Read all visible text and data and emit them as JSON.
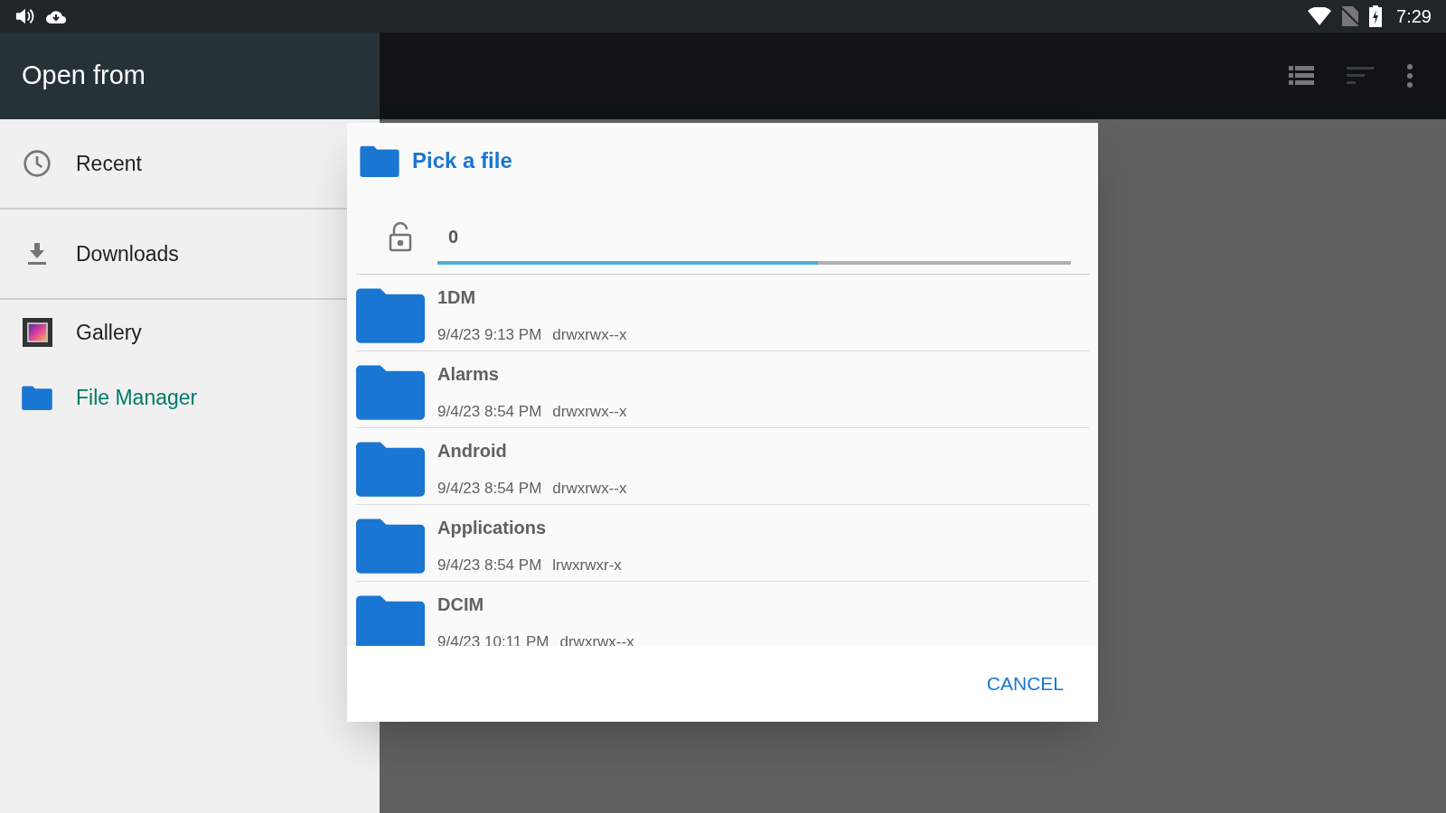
{
  "status_bar": {
    "time": "7:29"
  },
  "drawer": {
    "title": "Open from",
    "items": [
      {
        "label": "Recent",
        "kind": "recent",
        "selected": false,
        "divider_after": true
      },
      {
        "label": "Downloads",
        "kind": "downloads",
        "selected": false,
        "divider_after": true
      },
      {
        "label": "Gallery",
        "kind": "gallery",
        "selected": false,
        "divider_after": false
      },
      {
        "label": "File Manager",
        "kind": "folder",
        "selected": true,
        "divider_after": false
      }
    ]
  },
  "toolbar": {
    "sort_disabled": true
  },
  "dialog": {
    "title": "Pick a file",
    "path": {
      "value": "0",
      "level": 0.6
    },
    "files": [
      {
        "name": "1DM",
        "date": "9/4/23 9:13 PM",
        "permissions": "drwxrwx--x"
      },
      {
        "name": "Alarms",
        "date": "9/4/23 8:54 PM",
        "permissions": "drwxrwx--x"
      },
      {
        "name": "Android",
        "date": "9/4/23 8:54 PM",
        "permissions": "drwxrwx--x"
      },
      {
        "name": "Applications",
        "date": "9/4/23 8:54 PM",
        "permissions": "lrwxrwxr-x"
      },
      {
        "name": "DCIM",
        "date": "9/4/23 10:11 PM",
        "permissions": "drwxrwx--x"
      }
    ],
    "buttons": [
      "CANCEL"
    ]
  }
}
